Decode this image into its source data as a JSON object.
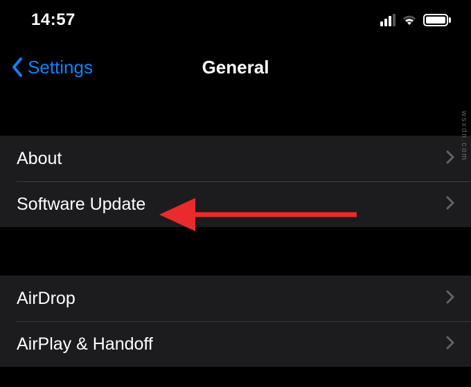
{
  "status_bar": {
    "time": "14:57"
  },
  "nav": {
    "back_label": "Settings",
    "title": "General"
  },
  "groups": [
    {
      "items": [
        {
          "label": "About"
        },
        {
          "label": "Software Update"
        }
      ]
    },
    {
      "items": [
        {
          "label": "AirDrop"
        },
        {
          "label": "AirPlay & Handoff"
        }
      ]
    }
  ],
  "annotation": {
    "arrow_color": "#ea2b2b"
  },
  "watermark": "wsxdn.com"
}
